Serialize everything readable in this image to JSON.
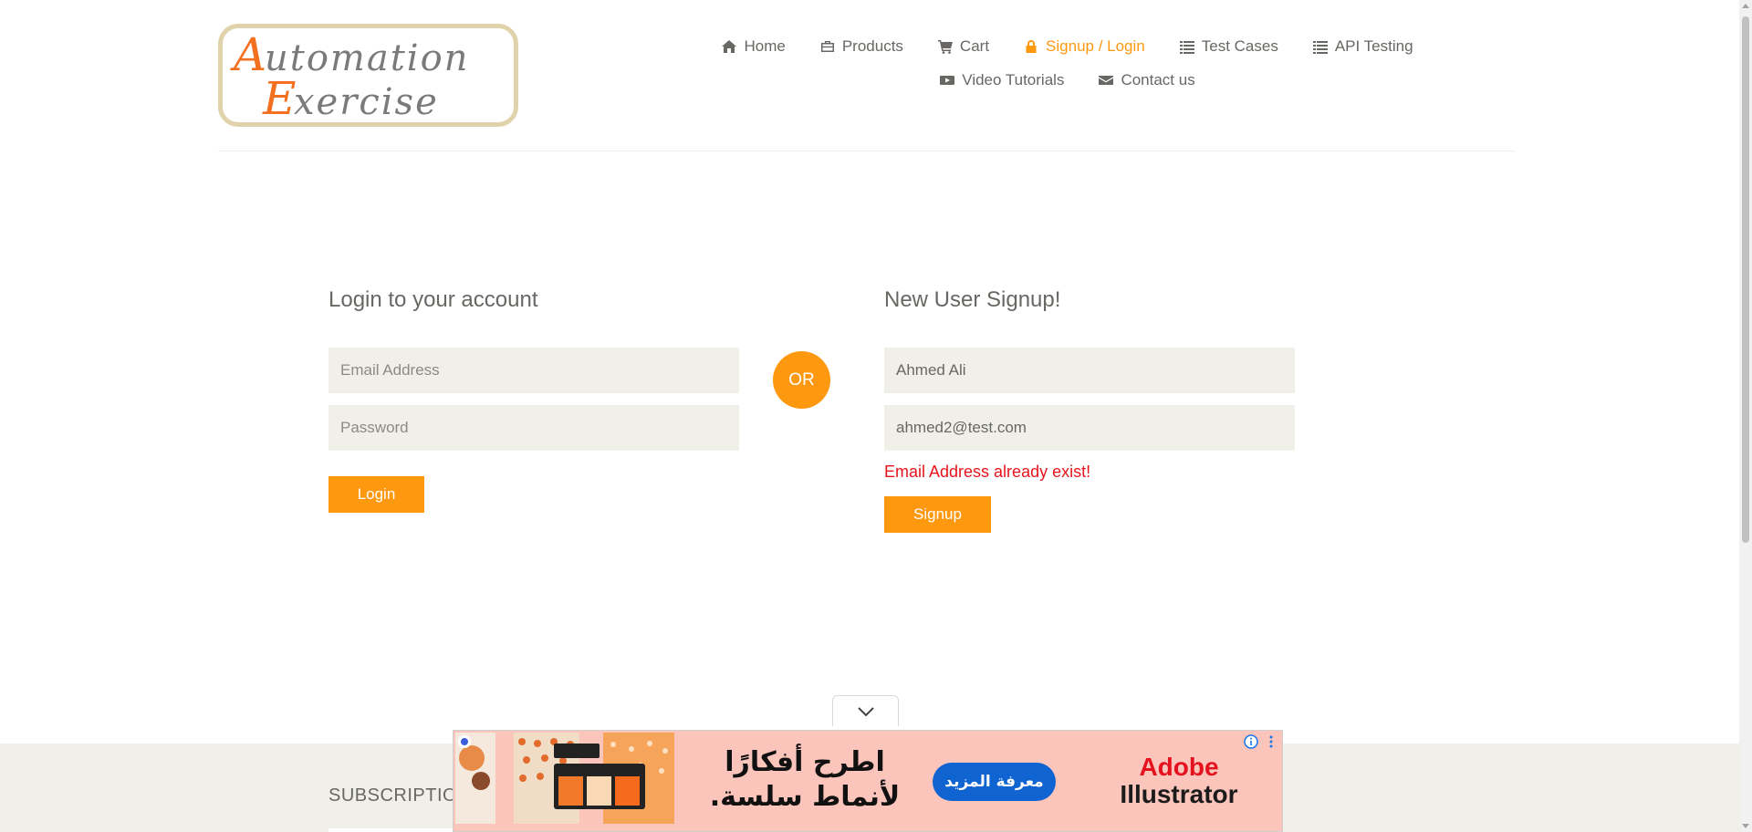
{
  "logo": {
    "line1": "Automation",
    "line2": "Exercise"
  },
  "nav": {
    "row1": [
      {
        "label": "Home",
        "icon": "home-icon"
      },
      {
        "label": "Products",
        "icon": "briefcase-icon"
      },
      {
        "label": "Cart",
        "icon": "cart-icon"
      },
      {
        "label": "Signup / Login",
        "icon": "lock-icon",
        "active": true
      },
      {
        "label": "Test Cases",
        "icon": "list-icon"
      },
      {
        "label": "API Testing",
        "icon": "list-icon"
      }
    ],
    "row2": [
      {
        "label": "Video Tutorials",
        "icon": "youtube-icon"
      },
      {
        "label": "Contact us",
        "icon": "envelope-icon"
      }
    ]
  },
  "login": {
    "title": "Login to your account",
    "email_placeholder": "Email Address",
    "password_placeholder": "Password",
    "button": "Login"
  },
  "or_label": "OR",
  "signup": {
    "title": "New User Signup!",
    "name_value": "Ahmed Ali",
    "email_value": "ahmed2@test.com",
    "error": "Email Address already exist!",
    "button": "Signup"
  },
  "footer": {
    "subscription_title": "SUBSCRIPTIO"
  },
  "ad": {
    "headline_line1": "اطرح أفكارًا",
    "headline_line2": "لأنماط سلسة.",
    "cta": "معرفة المزيد",
    "brand_line1": "Adobe",
    "brand_line2": "Illustrator"
  },
  "colors": {
    "accent": "#fe980f",
    "error": "#e8141c",
    "input_bg": "#f0f0e9",
    "ad_bg": "#fbc5bb",
    "ad_cta": "#0f64d2"
  }
}
